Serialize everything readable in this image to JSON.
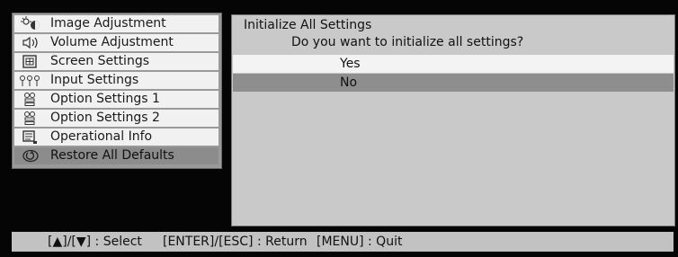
{
  "menu": {
    "items": [
      {
        "label": "Image Adjustment",
        "icon": "image-adjustment-icon"
      },
      {
        "label": "Volume Adjustment",
        "icon": "speaker-icon"
      },
      {
        "label": "Screen Settings",
        "icon": "screen-icon"
      },
      {
        "label": "Input Settings",
        "icon": "input-icon"
      },
      {
        "label": "Option Settings 1",
        "icon": "option-icon"
      },
      {
        "label": "Option Settings 2",
        "icon": "option-icon"
      },
      {
        "label": "Operational Info",
        "icon": "info-icon"
      },
      {
        "label": "Restore All Defaults",
        "icon": "restore-icon"
      }
    ],
    "selected": "Restore All Defaults"
  },
  "dialog": {
    "title": "Initialize All Settings",
    "question": "Do you want to initialize all settings?",
    "options": [
      {
        "label": "Yes"
      },
      {
        "label": "No"
      }
    ],
    "highlighted": "No"
  },
  "footer": {
    "select": "[▲]/[▼] : Select",
    "return": "[ENTER]/[ESC] : Return",
    "quit": "[MENU] : Quit"
  },
  "colors": {
    "screen_bg": "#050505",
    "menu_item_bg": "#f1f1f1",
    "selected_bg": "#8c8c8c",
    "dialog_bg": "#c9c9c9",
    "footer_bg": "#c2c2c2"
  }
}
